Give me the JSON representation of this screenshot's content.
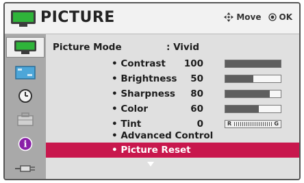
{
  "header": {
    "title": "PICTURE",
    "move_hint": "Move",
    "ok_hint": "OK"
  },
  "sidebar": {
    "items": [
      {
        "icon": "picture-icon",
        "selected": true
      },
      {
        "icon": "screen-icon",
        "selected": false
      },
      {
        "icon": "clock-icon",
        "selected": false
      },
      {
        "icon": "lock-icon",
        "selected": false
      },
      {
        "icon": "info-icon",
        "selected": false
      },
      {
        "icon": "input-icon",
        "selected": false
      }
    ]
  },
  "picture_mode": {
    "label": "Picture Mode",
    "value": ": Vivid"
  },
  "settings": [
    {
      "label": "• Contrast",
      "value": "100",
      "level": 1.0
    },
    {
      "label": "• Brightness",
      "value": "50",
      "level": 0.5
    },
    {
      "label": "• Sharpness",
      "value": "80",
      "level": 0.8
    },
    {
      "label": "• Color",
      "value": "60",
      "level": 0.6
    },
    {
      "label": "• Tint",
      "value": "0",
      "tint_left": "R",
      "tint_right": "G"
    }
  ],
  "advanced_control": "• Advanced Control",
  "picture_reset": "• Picture Reset",
  "colors": {
    "highlight": "#c8174d",
    "bar_fill": "#5e5e5e",
    "sidebar": "#a9a9a9"
  }
}
